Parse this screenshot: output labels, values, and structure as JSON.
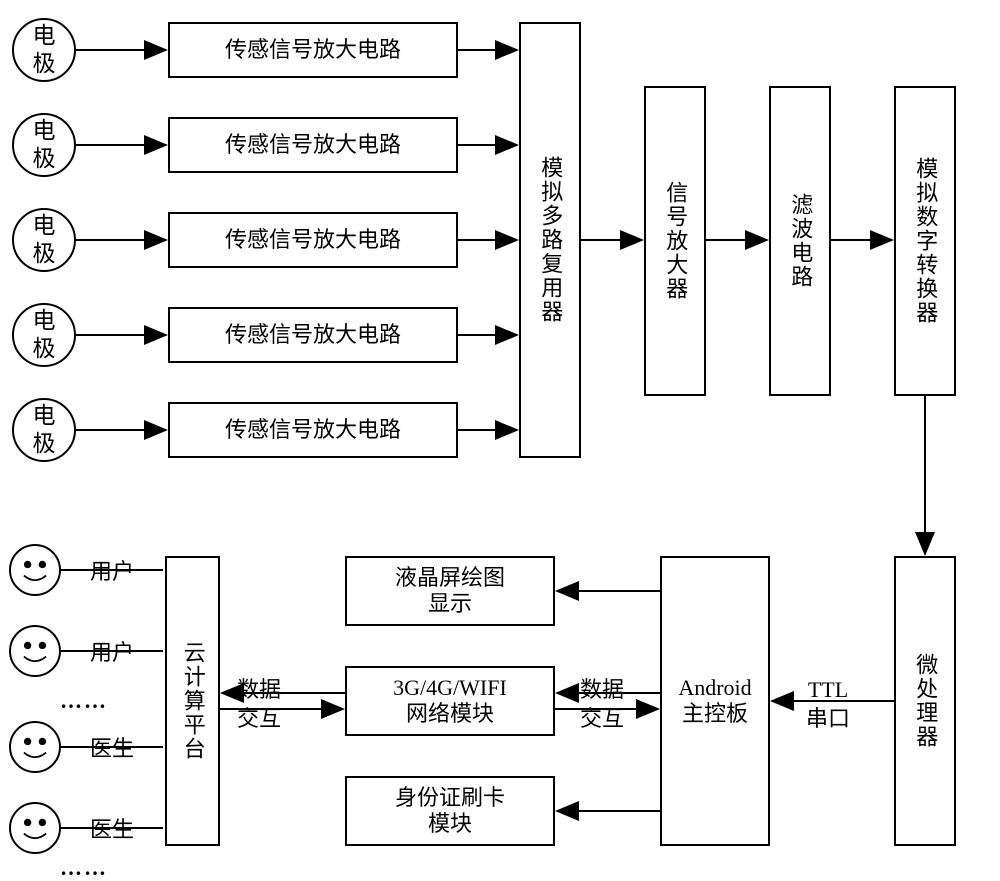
{
  "electrode": "电\n极",
  "sensor_amp": "传感信号放大电路",
  "mux": "模拟多路复用器",
  "sig_amp": "信号放大器",
  "filter": "滤波电路",
  "adc": "模拟数字转换器",
  "mcu": "微处理器",
  "ttl": "TTL\n串口",
  "android": "Android\n主控板",
  "lcd": "液晶屏绘图\n显示",
  "net": "3G/4G/WIFI\n网络模块",
  "idcard": "身份证刷卡\n模块",
  "data_ex": "数据\n交互",
  "cloud": "云计算平台",
  "user": "用户",
  "doctor": "医生",
  "dots": "……"
}
